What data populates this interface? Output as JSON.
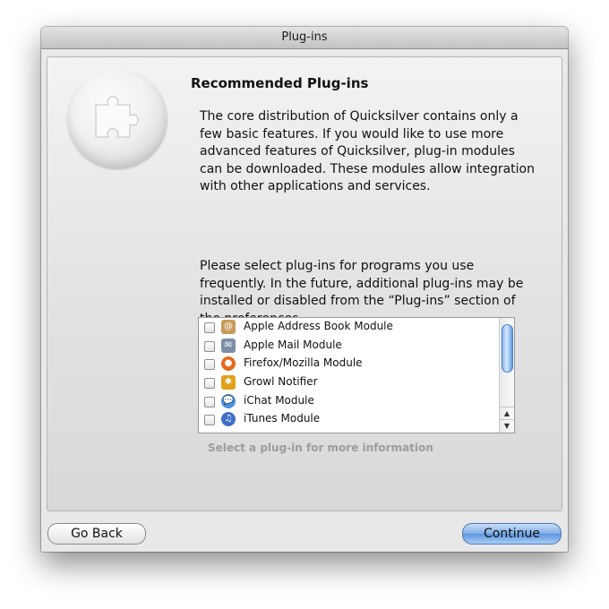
{
  "window": {
    "title": "Plug-ins"
  },
  "header": {
    "title": "Recommended Plug-ins"
  },
  "intro": {
    "paragraph1": "The core distribution of Quicksilver contains only a few basic features. If you would like to use more advanced features of Quicksilver, plug-in modules can be downloaded. These modules allow integration with other applications and services.",
    "paragraph2": "Please select plug-ins for programs you use frequently. In the future, additional plug-ins may be installed or disabled from the “Plug-ins” section of the preferences."
  },
  "plugins": [
    {
      "label": "Apple Address Book Module",
      "icon": "address-book-icon",
      "checked": false,
      "color": "#c89b5a"
    },
    {
      "label": "Apple Mail Module",
      "icon": "mail-icon",
      "checked": false,
      "color": "#7d8fa6"
    },
    {
      "label": "Firefox/Mozilla Module",
      "icon": "firefox-icon",
      "checked": false,
      "color": "#e56a1c"
    },
    {
      "label": "Growl Notifier",
      "icon": "growl-icon",
      "checked": false,
      "color": "#e2a11a"
    },
    {
      "label": "iChat Module",
      "icon": "ichat-icon",
      "checked": false,
      "color": "#4a90e2"
    },
    {
      "label": "iTunes Module",
      "icon": "itunes-icon",
      "checked": false,
      "color": "#3f6fc4"
    }
  ],
  "status": {
    "hint": "Select a plug-in for more information"
  },
  "buttons": {
    "back": "Go Back",
    "continue": "Continue"
  }
}
